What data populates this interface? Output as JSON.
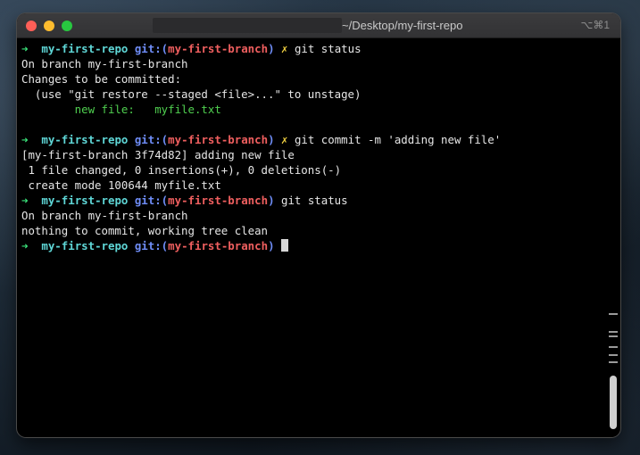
{
  "window": {
    "title": "~/Desktop/my-first-repo",
    "shortcut": "⌥⌘1"
  },
  "terminal": {
    "prompt_arrow": "➜",
    "repo": "my-first-repo",
    "git_prefix": "git:(",
    "branch": "my-first-branch",
    "git_suffix": ")",
    "dirty_mark": "✗",
    "cmd1": "git status",
    "out1_line1": "On branch my-first-branch",
    "out1_line2": "Changes to be committed:",
    "out1_line3": "  (use \"git restore --staged <file>...\" to unstage)",
    "out1_line4": "        new file:   myfile.txt",
    "cmd2": "git commit -m 'adding new file'",
    "out2_line1": "[my-first-branch 3f74d82] adding new file",
    "out2_line2": " 1 file changed, 0 insertions(+), 0 deletions(-)",
    "out2_line3": " create mode 100644 myfile.txt",
    "cmd3": "git status",
    "out3_line1": "On branch my-first-branch",
    "out3_line2": "nothing to commit, working tree clean"
  },
  "colors": {
    "arrow": "#3ae27a",
    "repo": "#5fd7d7",
    "git": "#6f8df7",
    "branch": "#ef5f5f",
    "dirty": "#f0d040",
    "staged_file": "#4fcf4f"
  }
}
